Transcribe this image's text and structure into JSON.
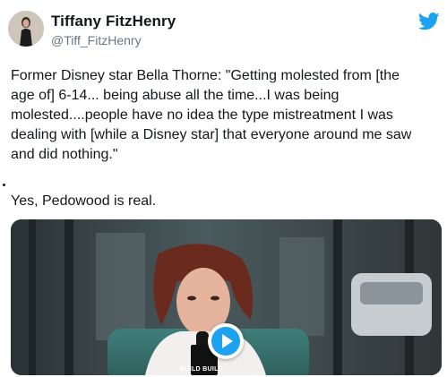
{
  "author": {
    "name": "Tiffany FitzHenry",
    "handle": "@Tiff_FitzHenry",
    "avatar_icon": "profile-photo"
  },
  "brand": {
    "icon": "twitter-bird-icon",
    "color": "#1da1f2"
  },
  "tweet": {
    "text_lines": [
      "Former Disney star Bella Thorne: \"Getting molested from [the",
      "age of] 6-14... being abuse all the time...I was being",
      "molested....people have no idea the type mistreatment I was",
      "dealing with [while a Disney star] that everyone around me saw",
      "and did nothing.\""
    ],
    "followup": "Yes, Pedowood is real."
  },
  "media": {
    "type": "video",
    "play_icon": "play-icon",
    "mic_flag_text": "BUILD BUILD"
  }
}
